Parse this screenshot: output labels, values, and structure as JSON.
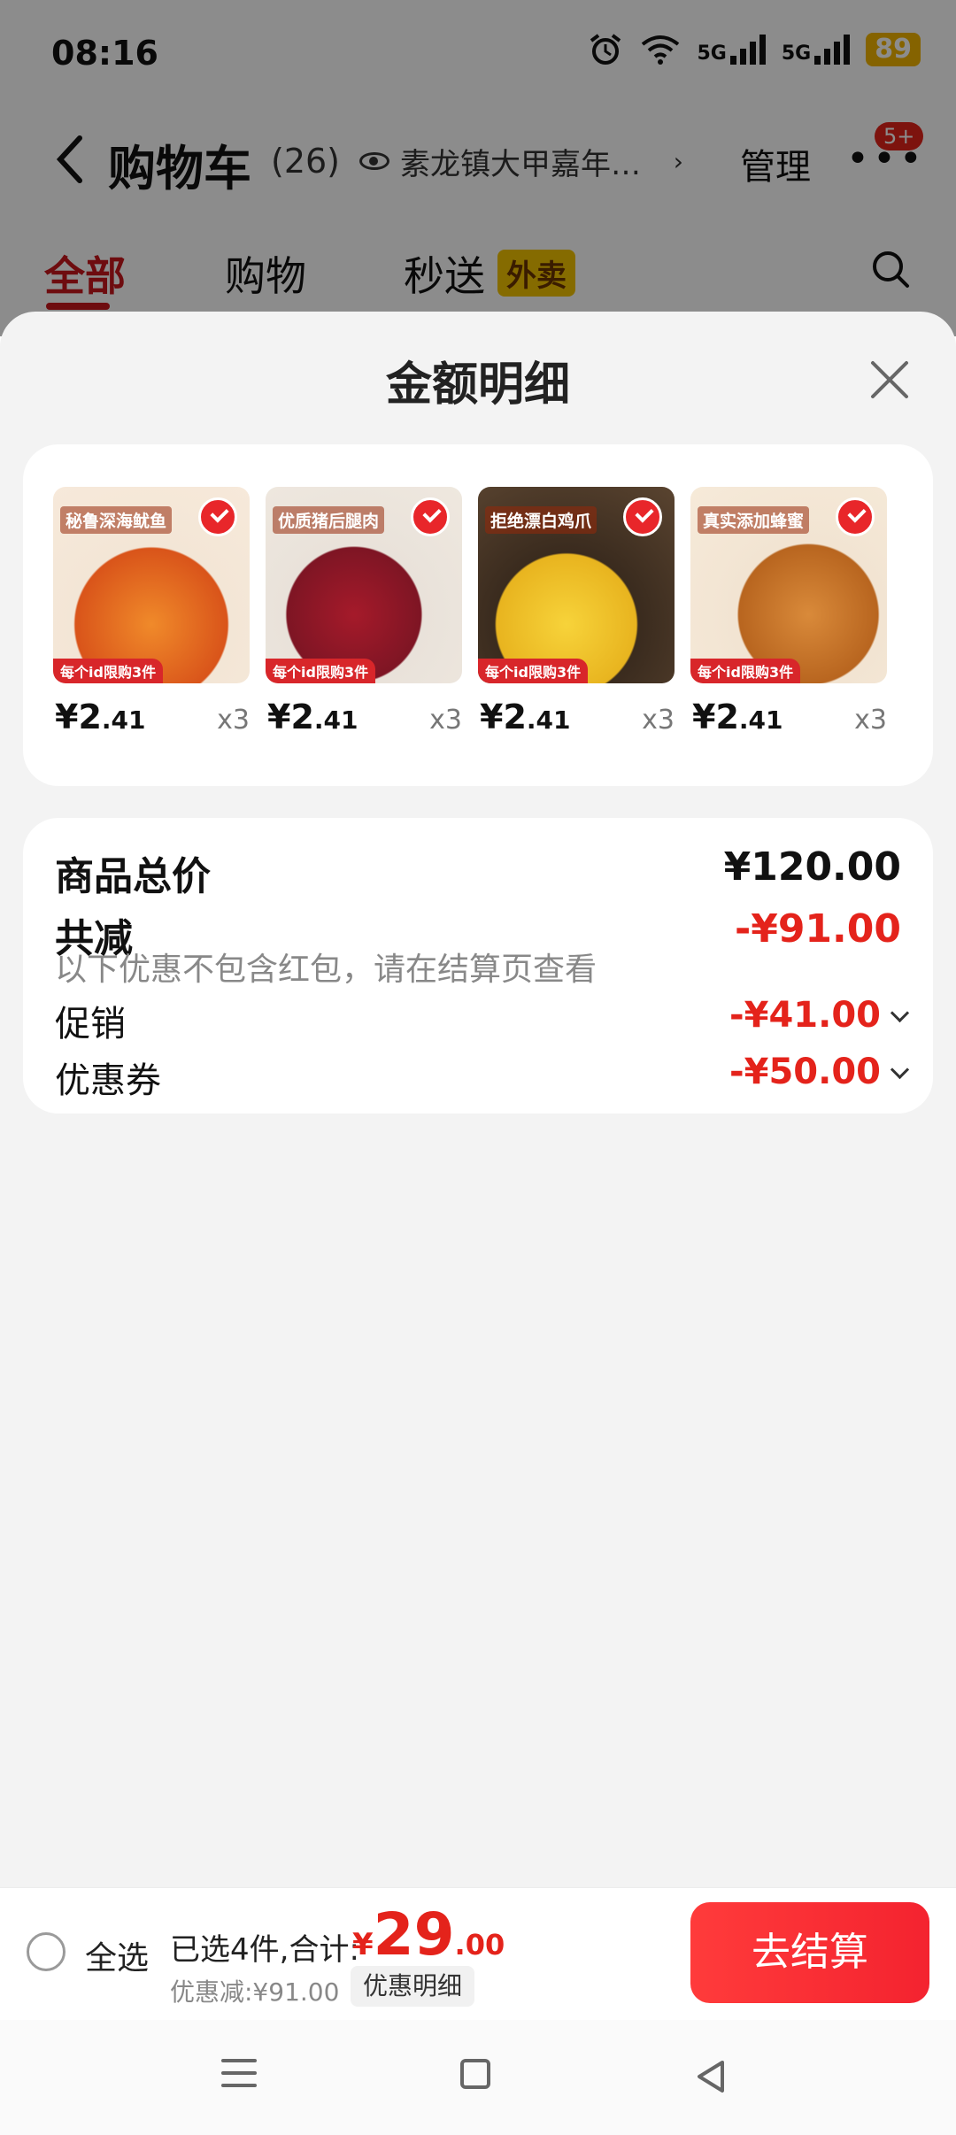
{
  "status": {
    "time": "08:16",
    "net1": "5G",
    "net2": "5G",
    "battery": "89"
  },
  "header": {
    "title": "购物车",
    "count": "(26)",
    "location": "素龙镇大甲嘉年…",
    "manage": "管理",
    "badge": "5+"
  },
  "tabs": [
    {
      "label": "全部"
    },
    {
      "label": "购物"
    },
    {
      "label": "秒送"
    }
  ],
  "tab_badge": "外卖",
  "sheet": {
    "title": "金额明细"
  },
  "products": [
    {
      "title": "秘鲁深海鱿鱼",
      "limit": "每个id限购3件",
      "price_int": "¥2",
      "price_dec": ".41",
      "qty": "x3"
    },
    {
      "title": "优质猪后腿肉",
      "limit": "每个id限购3件",
      "price_int": "¥2",
      "price_dec": ".41",
      "qty": "x3"
    },
    {
      "title": "拒绝漂白鸡爪",
      "limit": "每个id限购3件",
      "price_int": "¥2",
      "price_dec": ".41",
      "qty": "x3"
    },
    {
      "title": "真实添加蜂蜜",
      "limit": "每个id限购3件",
      "price_int": "¥2",
      "price_dec": ".41",
      "qty": "x3"
    }
  ],
  "summary": {
    "total_label": "商品总价",
    "total_value": "¥120.00",
    "reduce_label": "共减",
    "reduce_value": "-¥91.00",
    "note": "以下优惠不包含红包，请在结算页查看",
    "promo_label": "促销",
    "promo_value": "-¥41.00",
    "coupon_label": "优惠券",
    "coupon_value": "-¥50.00"
  },
  "checkout": {
    "select_all": "全选",
    "selected_text": "已选4件,合计:",
    "total_yen": "¥",
    "total_int": "29",
    "total_dec": ".00",
    "discount": "优惠减:¥91.00",
    "detail": "优惠明细",
    "button": "去结算"
  },
  "colors": {
    "accent": "#e4231b",
    "tab_active": "#c8161d",
    "sheet_bg": "#f3f3f3"
  }
}
